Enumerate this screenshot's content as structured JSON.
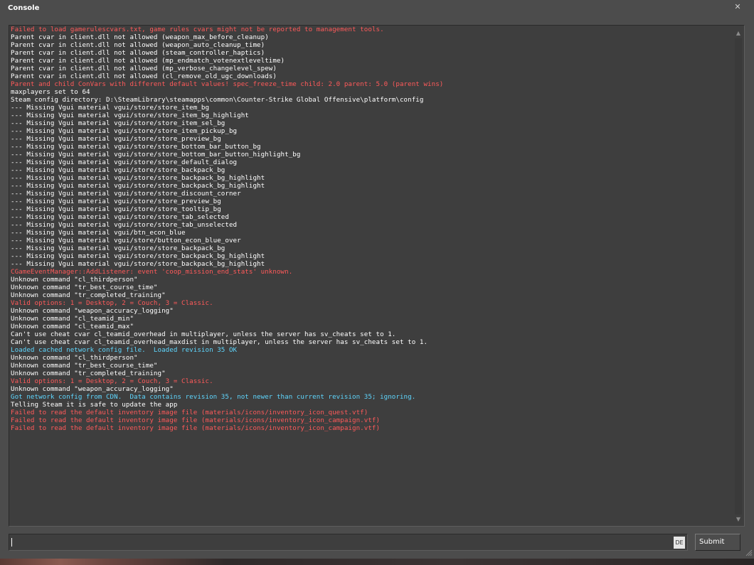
{
  "window": {
    "title": "Console",
    "close_glyph": "✕"
  },
  "log": [
    {
      "text": "Failed to load gamerulescvars.txt, game rules cvars might not be reported to management tools.",
      "color": "red"
    },
    {
      "text": "Parent cvar in client.dll not allowed (weapon_max_before_cleanup)",
      "color": "white"
    },
    {
      "text": "Parent cvar in client.dll not allowed (weapon_auto_cleanup_time)",
      "color": "white"
    },
    {
      "text": "Parent cvar in client.dll not allowed (steam_controller_haptics)",
      "color": "white"
    },
    {
      "text": "Parent cvar in client.dll not allowed (mp_endmatch_votenextleveltime)",
      "color": "white"
    },
    {
      "text": "Parent cvar in client.dll not allowed (mp_verbose_changelevel_spew)",
      "color": "white"
    },
    {
      "text": "Parent cvar in client.dll not allowed (cl_remove_old_ugc_downloads)",
      "color": "white"
    },
    {
      "text": "Parent and child ConVars with different default values! spec_freeze_time child: 2.0 parent: 5.0 (parent wins)",
      "color": "red"
    },
    {
      "text": "maxplayers set to 64",
      "color": "white"
    },
    {
      "text": "Steam config directory: D:\\SteamLibrary\\steamapps\\common\\Counter-Strike Global Offensive\\platform\\config",
      "color": "white"
    },
    {
      "text": "--- Missing Vgui material vgui/store/store_item_bg",
      "color": "white"
    },
    {
      "text": "--- Missing Vgui material vgui/store/store_item_bg_highlight",
      "color": "white"
    },
    {
      "text": "--- Missing Vgui material vgui/store/store_item_sel_bg",
      "color": "white"
    },
    {
      "text": "--- Missing Vgui material vgui/store/store_item_pickup_bg",
      "color": "white"
    },
    {
      "text": "--- Missing Vgui material vgui/store/store_preview_bg",
      "color": "white"
    },
    {
      "text": "--- Missing Vgui material vgui/store/store_bottom_bar_button_bg",
      "color": "white"
    },
    {
      "text": "--- Missing Vgui material vgui/store/store_bottom_bar_button_highlight_bg",
      "color": "white"
    },
    {
      "text": "--- Missing Vgui material vgui/store/store_default_dialog",
      "color": "white"
    },
    {
      "text": "--- Missing Vgui material vgui/store/store_backpack_bg",
      "color": "white"
    },
    {
      "text": "--- Missing Vgui material vgui/store/store_backpack_bg_highlight",
      "color": "white"
    },
    {
      "text": "--- Missing Vgui material vgui/store/store_backpack_bg_highlight",
      "color": "white"
    },
    {
      "text": "--- Missing Vgui material vgui/store/store_discount_corner",
      "color": "white"
    },
    {
      "text": "--- Missing Vgui material vgui/store/store_preview_bg",
      "color": "white"
    },
    {
      "text": "--- Missing Vgui material vgui/store/store_tooltip_bg",
      "color": "white"
    },
    {
      "text": "--- Missing Vgui material vgui/store/store_tab_selected",
      "color": "white"
    },
    {
      "text": "--- Missing Vgui material vgui/store/store_tab_unselected",
      "color": "white"
    },
    {
      "text": "--- Missing Vgui material vgui/btn_econ_blue",
      "color": "white"
    },
    {
      "text": "--- Missing Vgui material vgui/store/button_econ_blue_over",
      "color": "white"
    },
    {
      "text": "--- Missing Vgui material vgui/store/store_backpack_bg",
      "color": "white"
    },
    {
      "text": "--- Missing Vgui material vgui/store/store_backpack_bg_highlight",
      "color": "white"
    },
    {
      "text": "--- Missing Vgui material vgui/store/store_backpack_bg_highlight",
      "color": "white"
    },
    {
      "text": "CGameEventManager::AddListener: event 'coop_mission_end_stats' unknown.",
      "color": "red"
    },
    {
      "text": "Unknown command \"cl_thirdperson\"",
      "color": "white"
    },
    {
      "text": "Unknown command \"tr_best_course_time\"",
      "color": "white"
    },
    {
      "text": "Unknown command \"tr_completed_training\"",
      "color": "white"
    },
    {
      "text": "Valid options: 1 = Desktop, 2 = Couch, 3 = Classic.",
      "color": "red"
    },
    {
      "text": "Unknown command \"weapon_accuracy_logging\"",
      "color": "white"
    },
    {
      "text": "Unknown command \"cl_teamid_min\"",
      "color": "white"
    },
    {
      "text": "Unknown command \"cl_teamid_max\"",
      "color": "white"
    },
    {
      "text": "Can't use cheat cvar cl_teamid_overhead in multiplayer, unless the server has sv_cheats set to 1.",
      "color": "white"
    },
    {
      "text": "Can't use cheat cvar cl_teamid_overhead_maxdist in multiplayer, unless the server has sv_cheats set to 1.",
      "color": "white"
    },
    {
      "text": "Loaded cached network config file.  Loaded revision 35 OK",
      "color": "cyan"
    },
    {
      "text": "Unknown command \"cl_thirdperson\"",
      "color": "white"
    },
    {
      "text": "Unknown command \"tr_best_course_time\"",
      "color": "white"
    },
    {
      "text": "Unknown command \"tr_completed_training\"",
      "color": "white"
    },
    {
      "text": "Valid options: 1 = Desktop, 2 = Couch, 3 = Classic.",
      "color": "red"
    },
    {
      "text": "Unknown command \"weapon_accuracy_logging\"",
      "color": "white"
    },
    {
      "text": "Got network config from CDN.  Data contains revision 35, not newer than current revision 35; ignoring.",
      "color": "cyan"
    },
    {
      "text": "Telling Steam it is safe to update the app",
      "color": "white"
    },
    {
      "text": "Failed to read the default inventory image file (materials/icons/inventory_icon_quest.vtf)",
      "color": "red"
    },
    {
      "text": "Failed to read the default inventory image file (materials/icons/inventory_icon_campaign.vtf)",
      "color": "red"
    },
    {
      "text": "Failed to read the default inventory image file (materials/icons/inventory_icon_campaign.vtf)",
      "color": "red"
    }
  ],
  "colors": {
    "white": "#ffffff",
    "red": "#ff5a5a",
    "cyan": "#5fd7ff",
    "window_bg": "#4c4c4c",
    "log_bg": "#3e3e3e"
  },
  "input": {
    "value": "",
    "placeholder": "",
    "lang_badge": "DE"
  },
  "submit": {
    "label": "Submit"
  },
  "icons": {
    "close": "close-icon",
    "scroll_up": "scroll-up-arrow-icon",
    "scroll_down": "scroll-down-arrow-icon",
    "resize": "resize-grip-icon"
  }
}
